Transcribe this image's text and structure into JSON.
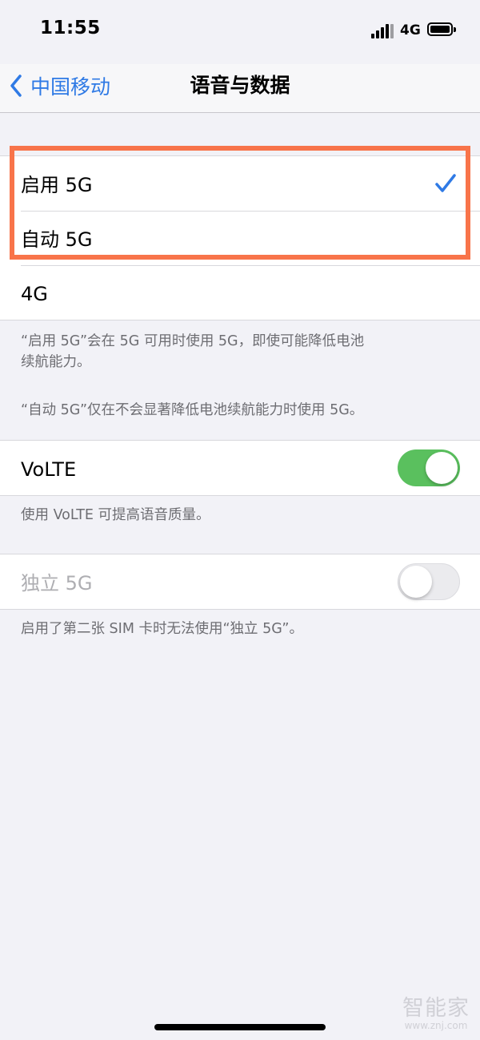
{
  "status_bar": {
    "time": "11:55",
    "network": "4G",
    "icons": [
      "signal-icon",
      "battery-icon"
    ]
  },
  "nav": {
    "back_label": "中国移动",
    "title": "语音与数据",
    "back_icon": "chevron-left-icon"
  },
  "options": [
    {
      "label": "启用 5G",
      "selected": true
    },
    {
      "label": "自动 5G",
      "selected": false
    },
    {
      "label": "4G",
      "selected": false
    }
  ],
  "options_footer": {
    "line1": "“启用 5G”会在 5G 可用时使用 5G，即使可能降低电池",
    "line2": "续航能力。",
    "line3": "“自动 5G”仅在不会显著降低电池续航能力时使用 5G。"
  },
  "volte": {
    "label": "VoLTE",
    "enabled": true,
    "footer": "使用 VoLTE 可提高语音质量。"
  },
  "sa5g": {
    "label": "独立 5G",
    "enabled": false,
    "disabled": true,
    "footer": "启用了第二张 SIM 卡时无法使用“独立 5G”。"
  },
  "watermark": {
    "text": "智能家",
    "url": "www.znj.com"
  },
  "colors": {
    "accent": "#2f7ae5",
    "toggle_on": "#5ac05e",
    "highlight": "#f8744a",
    "background": "#f2f2f7"
  }
}
